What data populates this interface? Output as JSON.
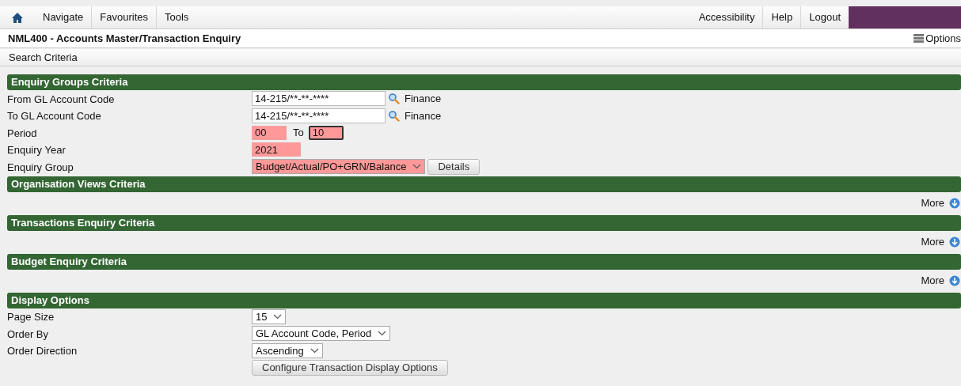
{
  "menu_bar": {
    "left": [
      "Navigate",
      "Favourites",
      "Tools"
    ],
    "right": [
      "Accessibility",
      "Help",
      "Logout"
    ]
  },
  "page_title": "NML400 - Accounts Master/Transaction Enquiry",
  "options_button": "Options",
  "breadcrumb": "Search Criteria",
  "sections": [
    {
      "title": "Enquiry Groups Criteria",
      "rows": [
        {
          "kind": "lookup",
          "label": "From GL Account Code",
          "value": "14-215/**-**-****",
          "required": false,
          "note": "Finance"
        },
        {
          "kind": "lookup",
          "label": "To GL Account Code",
          "value": "14-215/**-**-****",
          "required": false,
          "note": "Finance"
        },
        {
          "kind": "range",
          "label": "Period",
          "from": {
            "value": "00",
            "required": true,
            "focused": false
          },
          "separator": "To",
          "to": {
            "value": "10",
            "required": true,
            "focused": true
          }
        },
        {
          "kind": "input",
          "label": "Enquiry Year",
          "value": "2021",
          "required": true
        },
        {
          "kind": "select",
          "label": "Enquiry Group",
          "value": "Budget/Actual/PO+GRN/Balance",
          "required": true,
          "button": "Details"
        }
      ]
    },
    {
      "title": "Organisation Views Criteria",
      "more": "More"
    },
    {
      "title": "Transactions Enquiry Criteria",
      "more": "More"
    },
    {
      "title": "Budget Enquiry Criteria",
      "more": "More"
    },
    {
      "title": "Display Options",
      "rows": [
        {
          "kind": "select",
          "label": "Page Size",
          "value": "15",
          "required": false
        },
        {
          "kind": "select",
          "label": "Order By",
          "value": "GL Account Code, Period",
          "required": false
        },
        {
          "kind": "select",
          "label": "Order Direction",
          "value": "Ascending",
          "required": false
        },
        {
          "kind": "button",
          "label": "",
          "button": "Configure Transaction Display Options"
        }
      ]
    }
  ]
}
